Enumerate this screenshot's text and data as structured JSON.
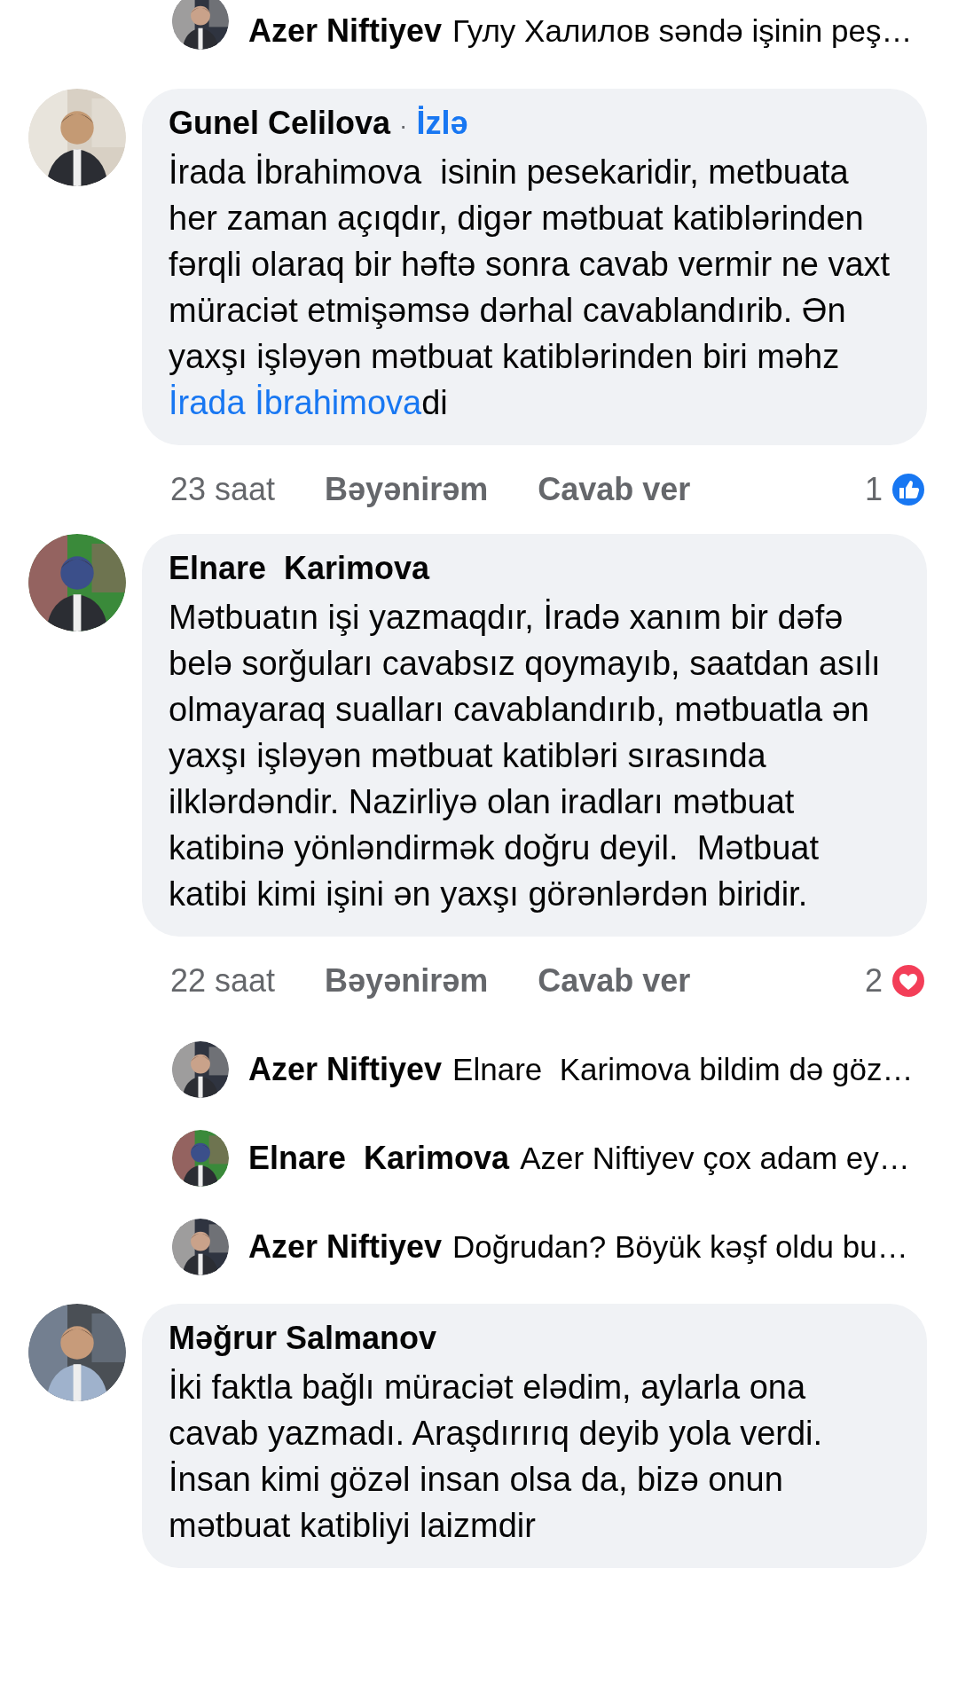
{
  "top_reply": {
    "author": "Azer Niftiyev",
    "text": "Гулу Халилов səndə işinin peş…"
  },
  "comments": [
    {
      "author": "Gunel Celilova",
      "separator": "·",
      "follow": "İzlə",
      "text": [
        {
          "kind": "text",
          "value": "İrada İbrahimova  isinin pesekaridir, metbuata her zaman açıqdır, digər mətbuat katiblərinden fərqli olaraq bir həftə sonra cavab vermir ne vaxt müraciət etmişəmsə dərhal cavablandırib. Ən yaxşı işləyən mətbuat katiblərinden biri məhz "
        },
        {
          "kind": "link",
          "value": "İrada İbrahimova"
        },
        {
          "kind": "text",
          "value": "di"
        }
      ],
      "time": "23 saat",
      "like": "Bəyənirəm",
      "reply": "Cavab ver",
      "reaction": {
        "kind": "like",
        "count": "1"
      }
    },
    {
      "author": "Elnare  Karimova",
      "text": [
        {
          "kind": "text",
          "value": "Mətbuatın işi yazmaqdır, İradə xanım bir dəfə belə sorğuları cavabsız qoymayıb, saatdan asılı olmayaraq sualları cavablandırıb, mətbuatla ən yaxşı işləyən mətbuat katibləri sırasında ilklərdəndir. Nazirliyə olan iradları mətbuat katibinə yönləndirmək doğru deyil.  Mətbuat katibi kimi işini ən yaxşı görənlərdən biridir."
        }
      ],
      "time": "22 saat",
      "like": "Bəyənirəm",
      "reply": "Cavab ver",
      "reaction": {
        "kind": "heart",
        "count": "2"
      },
      "replies": [
        {
          "author": "Azer Niftiyev",
          "text": "Elnare  Karimova bildim də göz…"
        },
        {
          "author": "Elnare  Karimova",
          "text": "Azer Niftiyev çox adam ey…"
        },
        {
          "author": "Azer Niftiyev",
          "text": "Doğrudan? Böyük kəşf oldu bu…"
        }
      ]
    },
    {
      "author": "Məğrur Salmanov",
      "text": [
        {
          "kind": "text",
          "value": "İki faktla bağlı müraciət elədim, aylarla ona cavab yazmadı. Araşdırırıq deyib yola verdi. İnsan kimi gözəl insan olsa da, bizə onun mətbuat katibliyi laizmdir"
        }
      ]
    }
  ]
}
